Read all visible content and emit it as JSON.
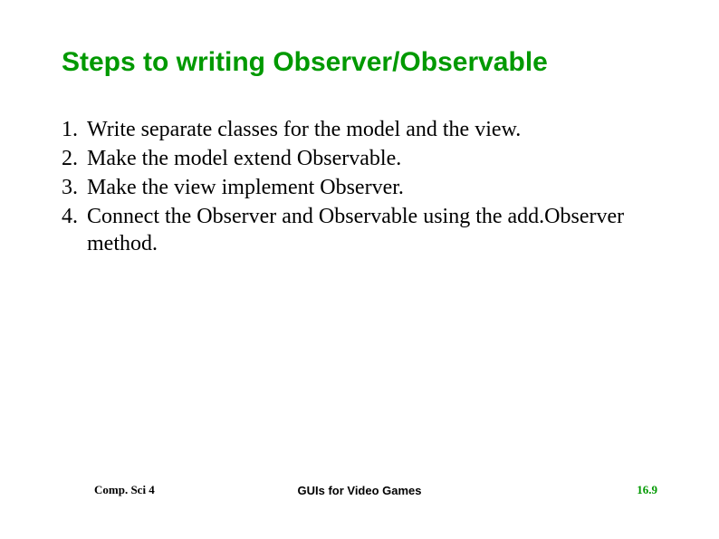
{
  "slide": {
    "title": "Steps to writing Observer/Observable",
    "items": [
      {
        "number": "1.",
        "text": "Write separate classes for the model and the view."
      },
      {
        "number": "2.",
        "text": "Make the model extend Observable."
      },
      {
        "number": "3.",
        "text": "Make the view implement Observer."
      },
      {
        "number": "4.",
        "text": "Connect the Observer and Observable using the add.Observer method."
      }
    ],
    "footer": {
      "left": "Comp. Sci 4",
      "center": "GUIs for Video Games",
      "right": "16.9"
    }
  }
}
